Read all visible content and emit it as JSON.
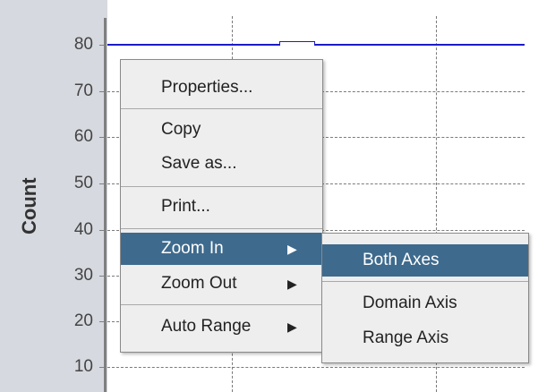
{
  "chart": {
    "y_axis_title": "Count",
    "y_ticks": [
      "80",
      "70",
      "60",
      "50",
      "40",
      "30",
      "20",
      "10"
    ],
    "series_color": "#1c1cc9"
  },
  "context_menu": {
    "items": [
      {
        "label": "Properties..."
      },
      {
        "label": "Copy"
      },
      {
        "label": "Save as..."
      },
      {
        "label": "Print..."
      },
      {
        "label": "Zoom In",
        "has_submenu": true,
        "selected": true
      },
      {
        "label": "Zoom Out",
        "has_submenu": true
      },
      {
        "label": "Auto Range",
        "has_submenu": true
      }
    ],
    "submenu_arrow": "▶",
    "highlight_color": "#3e6a8d"
  },
  "zoom_in_submenu": {
    "items": [
      {
        "label": "Both Axes",
        "selected": true
      },
      {
        "label": "Domain Axis"
      },
      {
        "label": "Range Axis"
      }
    ]
  }
}
